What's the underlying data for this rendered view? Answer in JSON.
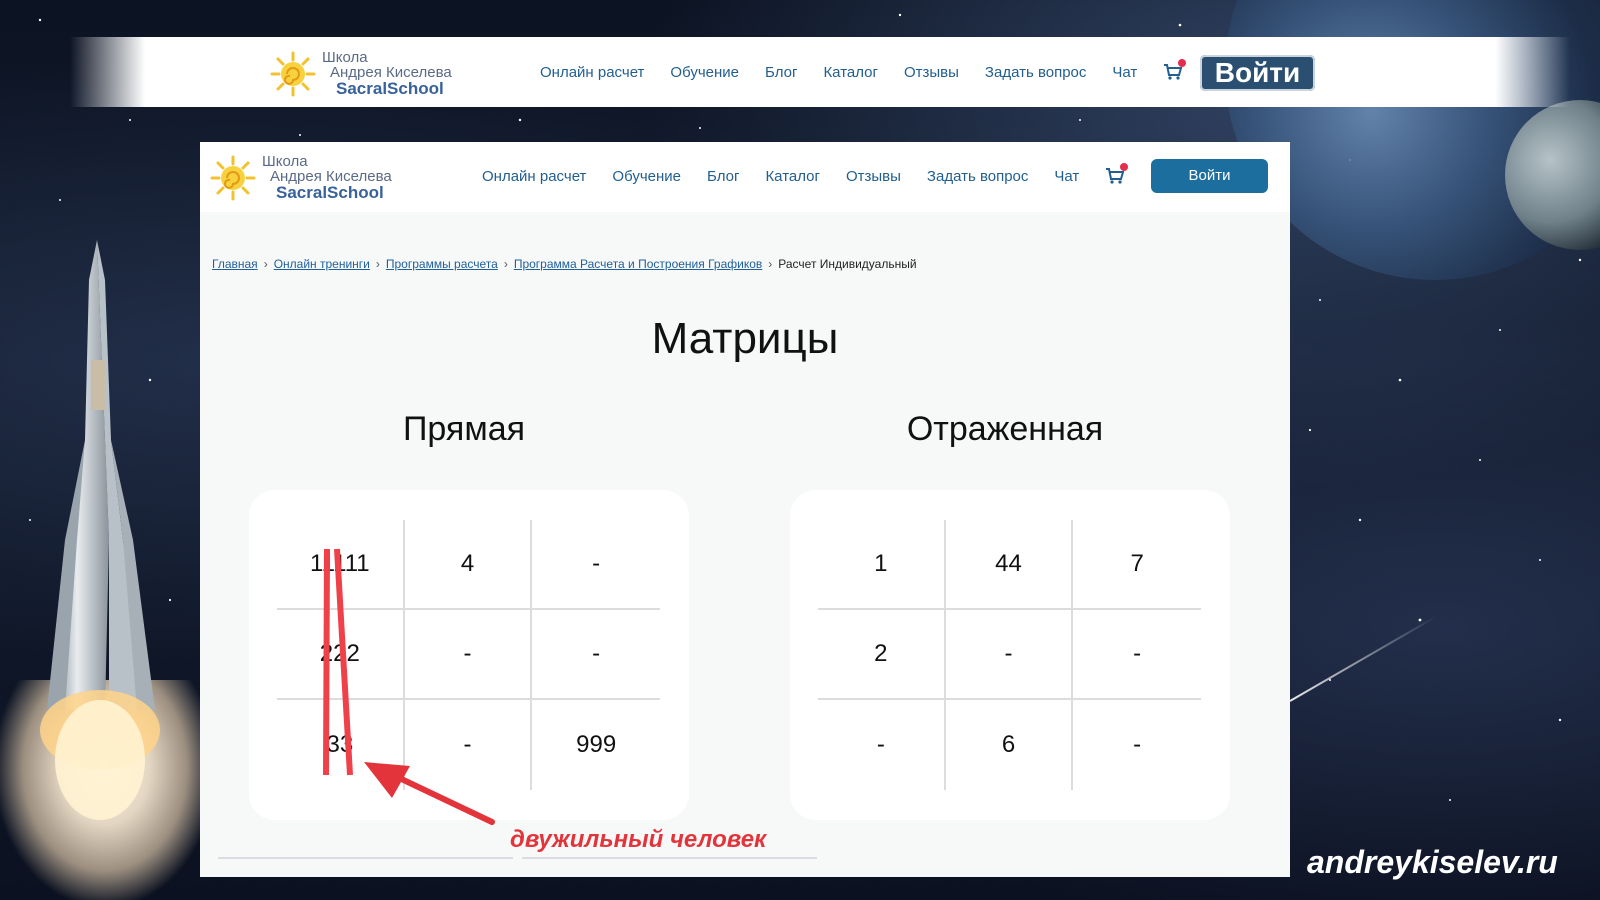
{
  "brand": {
    "line1": "Школа",
    "line2": "Андрея Киселева",
    "line3": "SacralSchool"
  },
  "nav": {
    "items": [
      "Онлайн расчет",
      "Обучение",
      "Блог",
      "Каталог",
      "Отзывы",
      "Задать вопрос",
      "Чат"
    ],
    "login": "Войти"
  },
  "breadcrumb": {
    "links": [
      "Главная",
      "Онлайн тренинги",
      "Программы расчета",
      "Программа Расчета и Построения Графиков"
    ],
    "current": "Расчет Индивидуальный"
  },
  "page_title": "Матрицы",
  "matrices": [
    {
      "title": "Прямая",
      "cells": [
        "11111",
        "4",
        "-",
        "222",
        "-",
        "-",
        "33",
        "-",
        "999"
      ]
    },
    {
      "title": "Отраженная",
      "cells": [
        "1",
        "44",
        "7",
        "2",
        "-",
        "-",
        "-",
        "6",
        "-"
      ]
    }
  ],
  "annotation": "двужильный человек",
  "site": "andreykiselev.ru",
  "colors": {
    "accent": "#1c6e9e",
    "nav_link": "#225f8f",
    "annotation": "#e2343a"
  }
}
